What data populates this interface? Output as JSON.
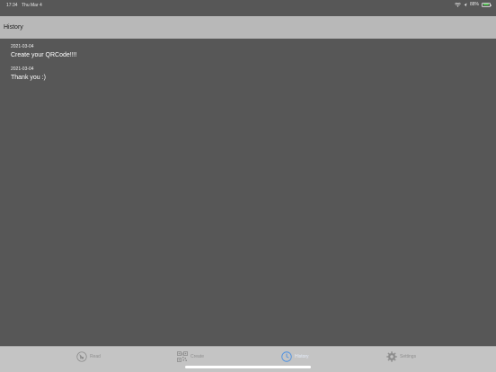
{
  "status_bar": {
    "time": "17:34",
    "date": "Thu Mar 4",
    "battery_percent": "88%",
    "battery_level": 0.88,
    "battery_color": "#5ac35a"
  },
  "nav_bar": {
    "title": "History"
  },
  "history": {
    "items": [
      {
        "date": "2021-03-04",
        "text": "Create your QRCode!!!!"
      },
      {
        "date": "2021-03-04",
        "text": "Thank you :)"
      }
    ]
  },
  "tab_bar": {
    "tabs": [
      {
        "label": "Read",
        "icon": "qr-scan-icon",
        "selected": false
      },
      {
        "label": "Create",
        "icon": "qr-code-icon",
        "selected": false
      },
      {
        "label": "History",
        "icon": "clock-icon",
        "selected": true
      },
      {
        "label": "Settings",
        "icon": "gear-icon",
        "selected": false
      }
    ],
    "accent_color": "#4a90e2"
  }
}
